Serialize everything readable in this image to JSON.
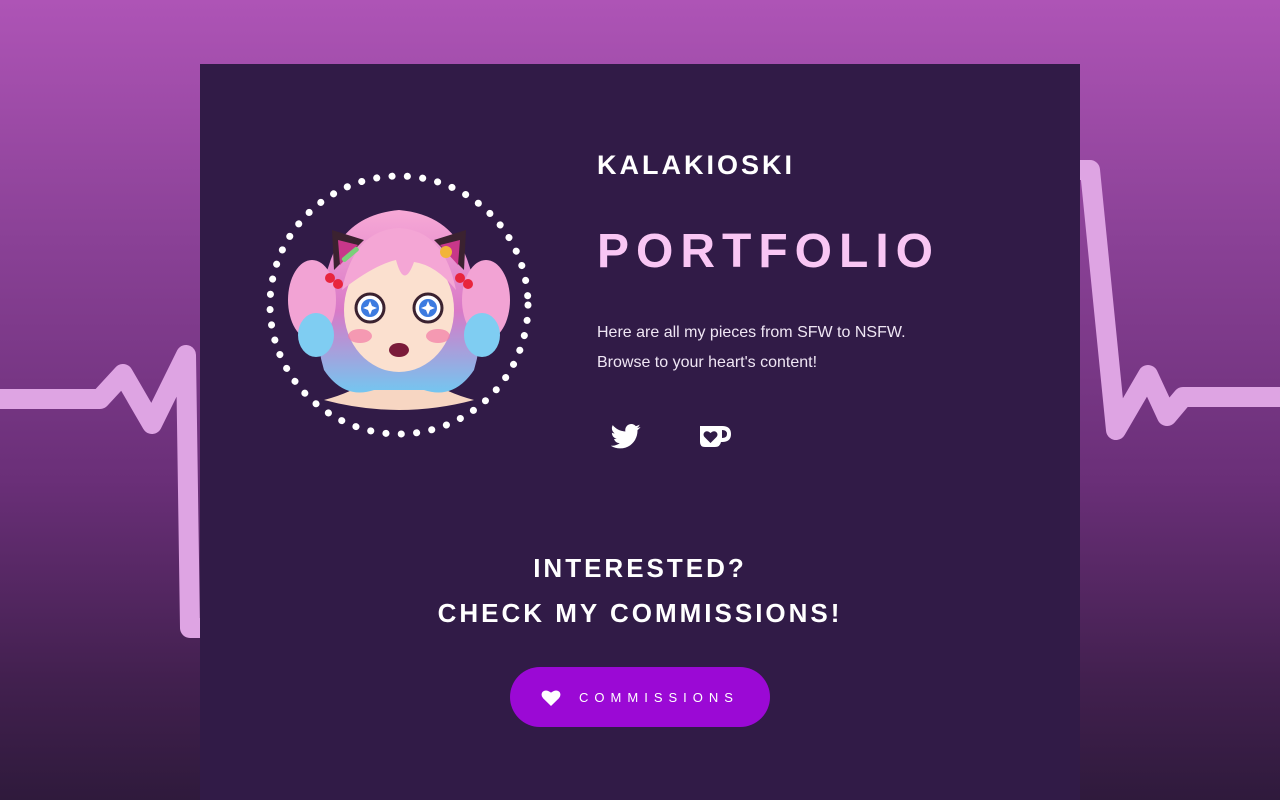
{
  "colors": {
    "card_background": "#311b47",
    "title_color": "#f9c6f4",
    "button_color": "#9b09d5",
    "pulse_line_color": "#dea4e3"
  },
  "profile": {
    "brand_name": "KALAKIOSKI",
    "page_title": "PORTFOLIO",
    "description_lines": [
      "Here are all my pieces from SFW to NSFW.",
      "Browse to your heart's content!"
    ]
  },
  "social": [
    {
      "icon": "twitter-icon"
    },
    {
      "icon": "kofi-icon"
    }
  ],
  "cta": {
    "line1": "INTERESTED?",
    "line2": "CHECK MY COMMISSIONS!"
  },
  "commissions_button": {
    "icon": "heart-icon",
    "label": "COMMISSIONS"
  }
}
